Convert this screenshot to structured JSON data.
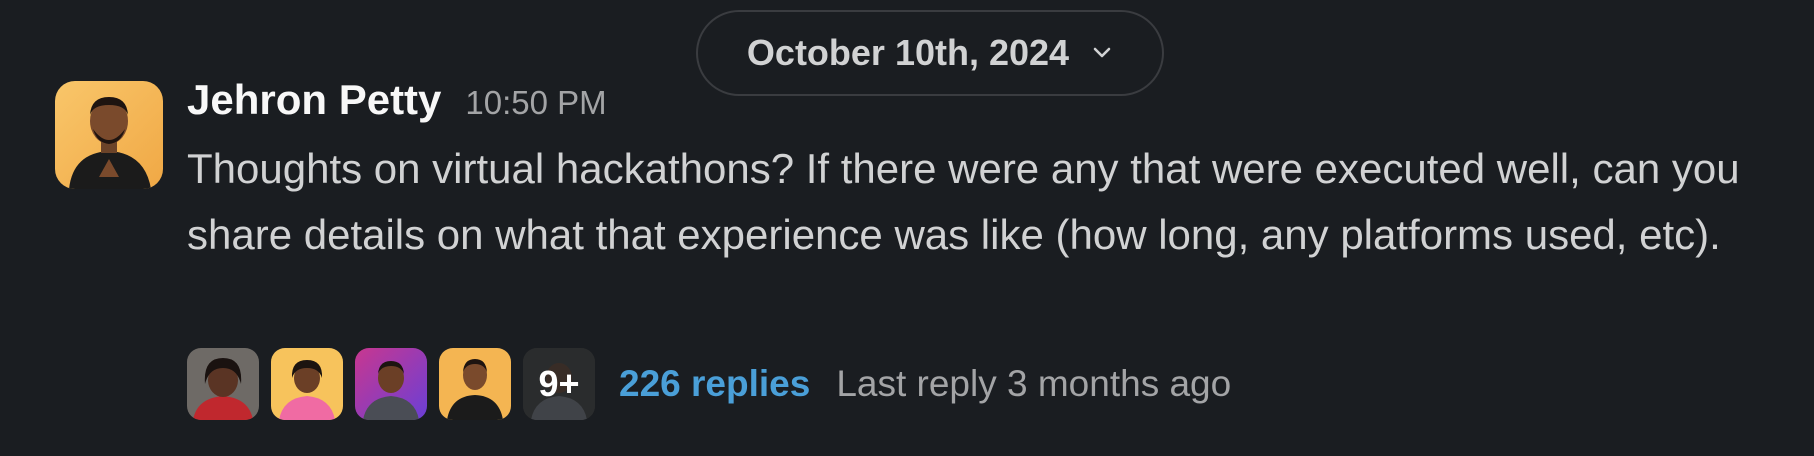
{
  "date_divider": {
    "label": "October 10th, 2024",
    "icon": "chevron-down-icon"
  },
  "message": {
    "author": "Jehron Petty",
    "time": "10:50 PM",
    "text": "Thoughts on virtual hackathons? If there were any that were executed well, can you share details on what that experience was like (how long, any platforms used, etc)."
  },
  "thread": {
    "more_count": "9+",
    "replies": "226 replies",
    "last_reply": "Last reply 3 months ago"
  },
  "colors": {
    "background": "#1a1d21",
    "link": "#4a9fd8",
    "muted": "#a3a4a6"
  }
}
